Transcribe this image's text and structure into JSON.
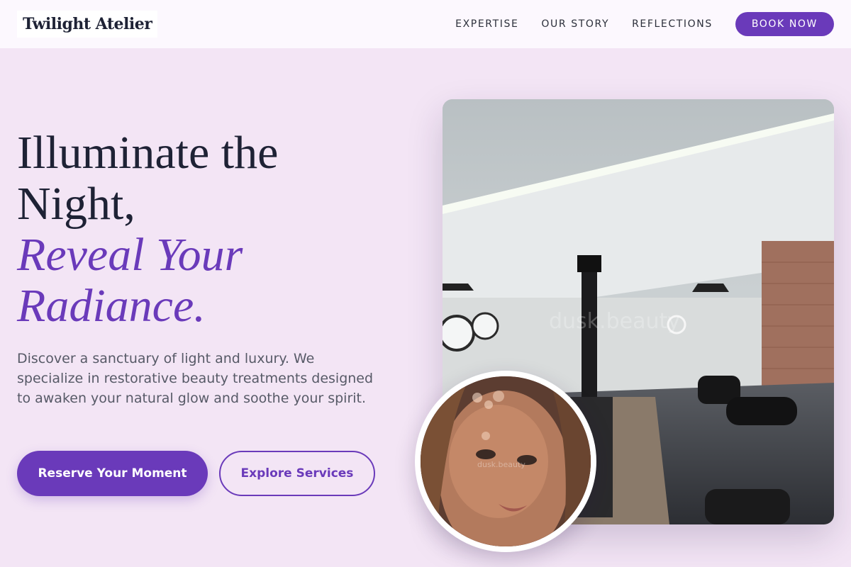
{
  "header": {
    "brand": "Twilight Atelier",
    "nav": [
      "EXPERTISE",
      "OUR STORY",
      "REFLECTIONS"
    ],
    "cta": "BOOK NOW"
  },
  "hero": {
    "title_line1": "Illuminate the",
    "title_line2": "Night,",
    "title_accent1": "Reveal Your",
    "title_accent2": "Radiance.",
    "description": "Discover a sanctuary of light and luxury. We specialize in restorative beauty treatments designed to awaken your natural glow and soothe your spirit.",
    "primary_button": "Reserve Your Moment",
    "secondary_button": "Explore Services"
  },
  "images": {
    "salon_watermark": "dusk.beauty",
    "portrait_watermark": "dusk.beauty"
  },
  "colors": {
    "accent": "#6a3aba",
    "background": "#f3e5f5",
    "heading": "#1e2235"
  }
}
